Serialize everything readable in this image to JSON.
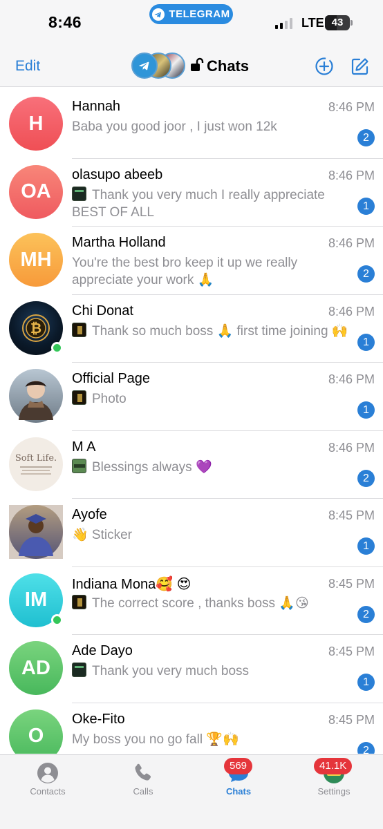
{
  "status_bar": {
    "time": "8:46",
    "app_pill": "TELEGRAM",
    "network": "LTE",
    "battery": "43"
  },
  "header": {
    "edit_label": "Edit",
    "title": "Chats"
  },
  "chats": [
    {
      "name": "Hannah",
      "initials": "H",
      "avatar_color": "#f2545b",
      "time": "8:46 PM",
      "preview": "Baba you good joor , I just won 12k",
      "thumb": "",
      "unread": "2",
      "online": false
    },
    {
      "name": "olasupo abeeb",
      "initials": "OA",
      "avatar_color": "#f06a67",
      "time": "8:46 PM",
      "preview": "Thank you very much I really appreciate BEST OF ALL",
      "thumb": "green",
      "unread": "1",
      "online": false
    },
    {
      "name": "Martha Holland",
      "initials": "MH",
      "avatar_color": "#f9a845",
      "time": "8:46 PM",
      "preview": "You're the best bro keep it up we really appreciate your work 🙏",
      "thumb": "",
      "unread": "2",
      "online": false
    },
    {
      "name": "Chi Donat",
      "initials": "",
      "avatar_color": "#0b1a2a",
      "time": "8:46 PM",
      "preview": "Thank so much boss 🙏 first time joining 🙌",
      "thumb": "gold",
      "unread": "1",
      "online": true
    },
    {
      "name": "Official Page",
      "initials": "",
      "avatar_color": "#7a8894",
      "time": "8:46 PM",
      "preview": "Photo",
      "thumb": "gold",
      "unread": "1",
      "online": false
    },
    {
      "name": "M A",
      "initials": "",
      "avatar_color": "#efe7de",
      "time": "8:46 PM",
      "preview": "Blessings always 💜",
      "thumb": "card",
      "unread": "2",
      "online": false
    },
    {
      "name": "Ayofe",
      "initials": "",
      "avatar_color": "#3a4a8a",
      "time": "8:45 PM",
      "preview": "👋 Sticker",
      "thumb": "",
      "unread": "1",
      "online": false
    },
    {
      "name": "Indiana Mona🥰 😍",
      "initials": "IM",
      "avatar_color": "#25c9d8",
      "time": "8:45 PM",
      "preview": "The correct score , thanks boss 🙏😘",
      "thumb": "gold",
      "unread": "2",
      "online": true
    },
    {
      "name": "Ade Dayo",
      "initials": "AD",
      "avatar_color": "#52c26a",
      "time": "8:45 PM",
      "preview": "Thank you very much boss",
      "thumb": "green",
      "unread": "1",
      "online": false
    },
    {
      "name": "Oke-Fito",
      "initials": "O",
      "avatar_color": "#55c266",
      "time": "8:45 PM",
      "preview": "My boss you no go fall 🏆🙌",
      "thumb": "",
      "unread": "2",
      "online": false
    }
  ],
  "avatar_images": {
    "soft_life_text": "Soft Life."
  },
  "tab_bar": {
    "contacts_label": "Contacts",
    "calls_label": "Calls",
    "chats_label": "Chats",
    "chats_badge": "569",
    "settings_label": "Settings",
    "settings_badge": "41.1K"
  },
  "colors": {
    "accent": "#2a7fd6",
    "badge_red": "#e5353b",
    "online_green": "#34c759"
  }
}
